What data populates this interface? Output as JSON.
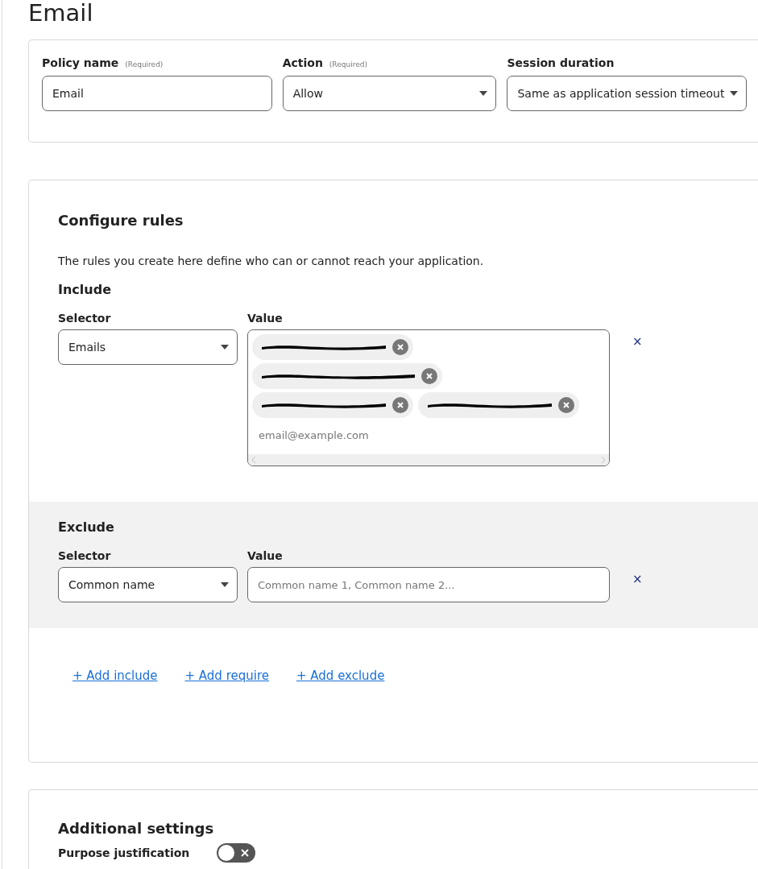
{
  "page_title": "Email",
  "policy": {
    "fields": [
      {
        "label": "Policy name",
        "hint": "(Required)",
        "kind": "text",
        "value": "Email"
      },
      {
        "label": "Action",
        "hint": "(Required)",
        "kind": "select",
        "value": "Allow"
      },
      {
        "label": "Session duration",
        "kind": "select",
        "value": "Same as application session timeout"
      }
    ]
  },
  "rules": {
    "title": "Configure rules",
    "description": "The rules you create here define who can or cannot reach your application.",
    "groups": [
      {
        "title": "Include",
        "shaded": false,
        "selector_label": "Selector",
        "value_label": "Value",
        "selector": "Emails",
        "chips": [
          {
            "kind": "redacted"
          },
          {
            "kind": "redacted"
          },
          {
            "kind": "redacted"
          },
          {
            "kind": "redacted"
          }
        ],
        "placeholder": "email@example.com",
        "remove": "×"
      },
      {
        "title": "Exclude",
        "shaded": true,
        "selector_label": "Selector",
        "value_label": "Value",
        "selector": "Common name",
        "placeholder": "Common name 1, Common name 2...",
        "remove": "×"
      }
    ],
    "links": [
      "+ Add include",
      "+ Add require",
      "+ Add exclude"
    ]
  },
  "additional": {
    "title": "Additional settings",
    "settings": [
      {
        "label": "Purpose justification",
        "on": false
      }
    ]
  }
}
